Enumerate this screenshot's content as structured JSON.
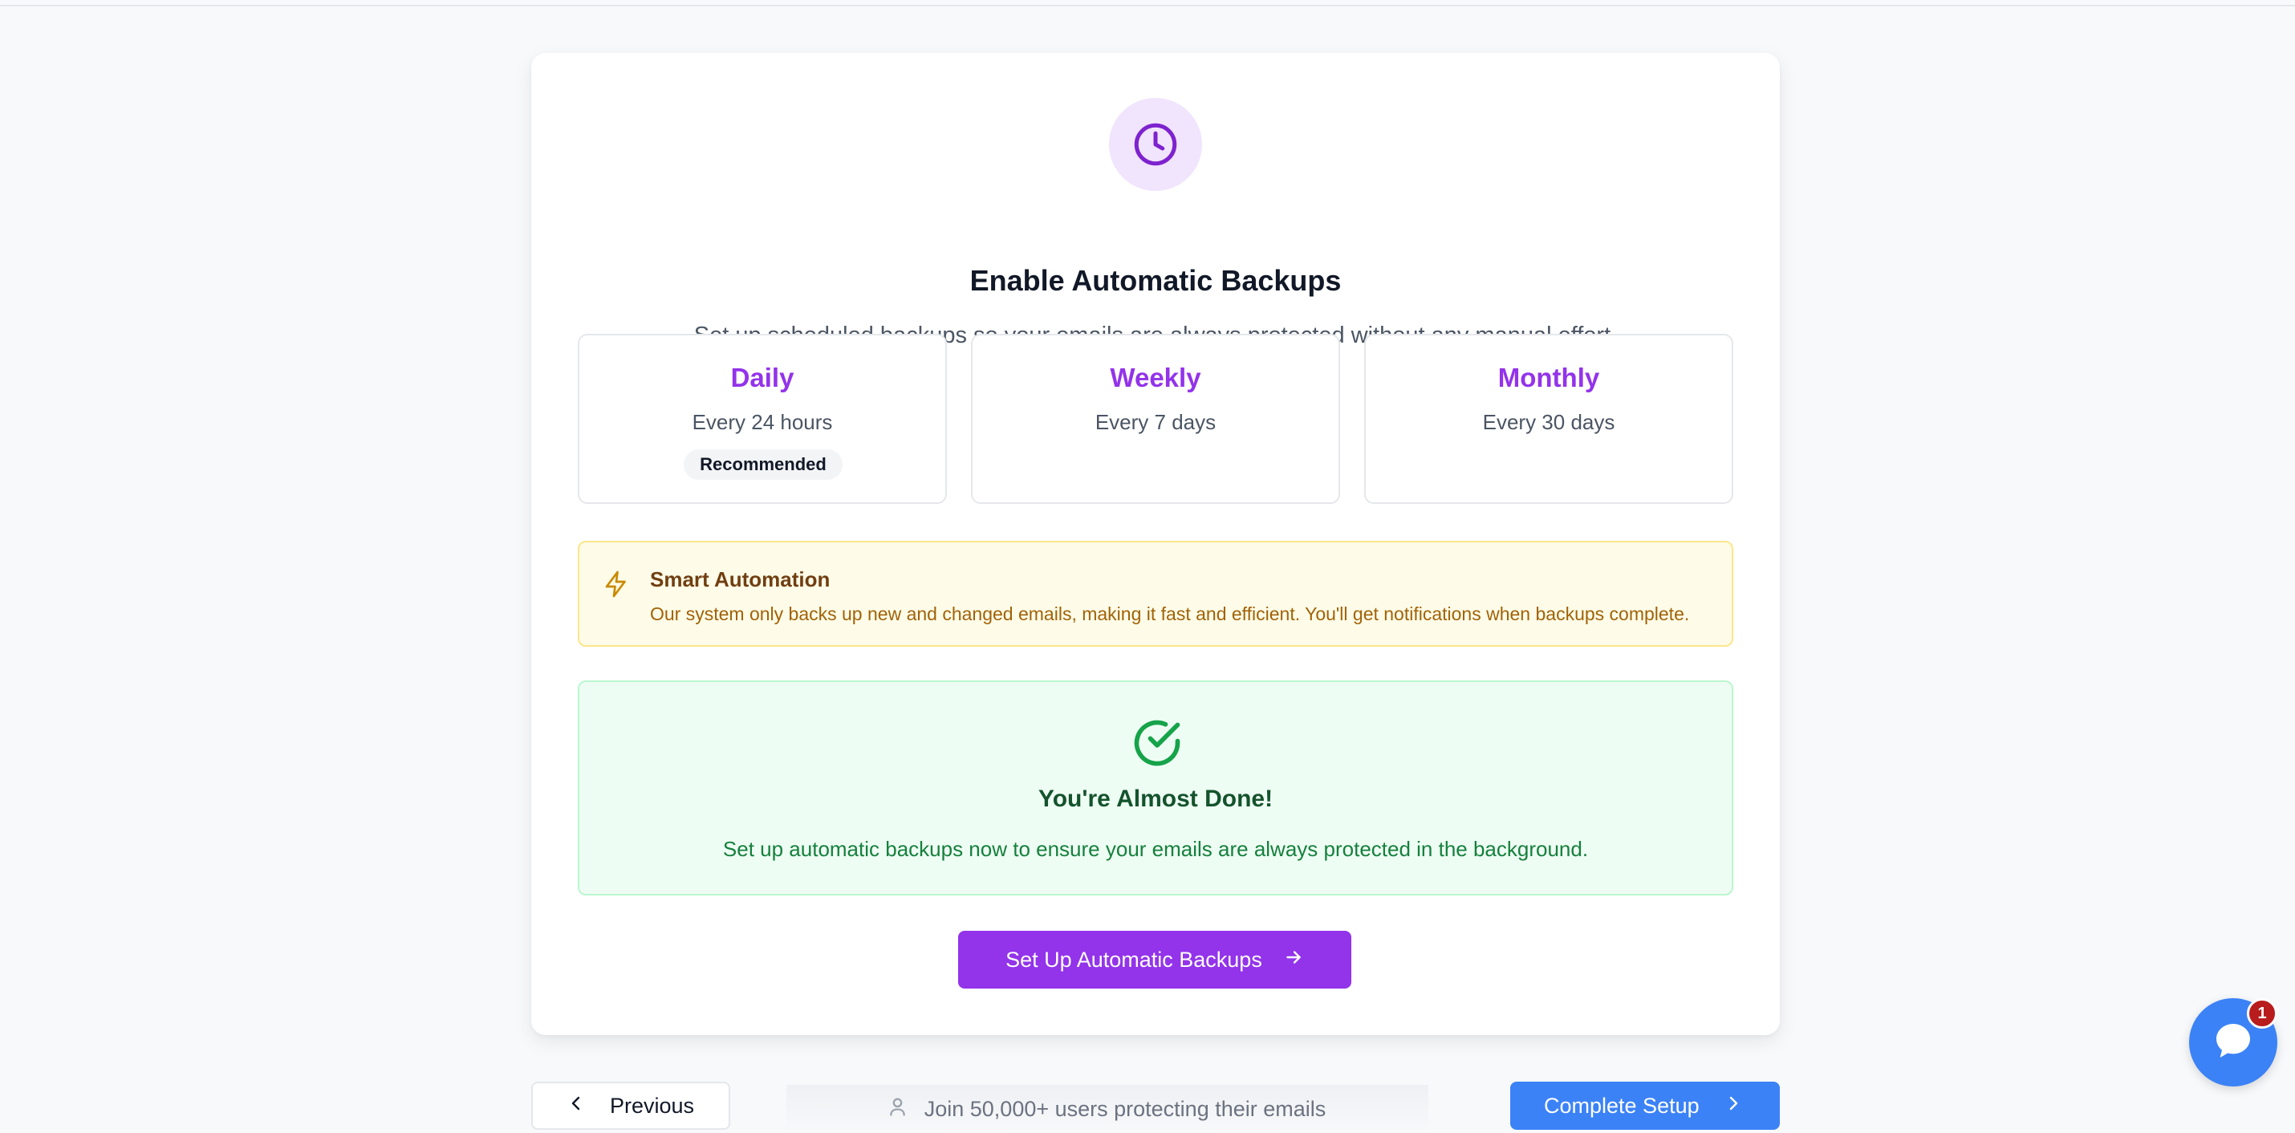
{
  "header": {
    "title": "Enable Automatic Backups",
    "subtitle": "Set up scheduled backups so your emails are always protected without any manual effort."
  },
  "frequencies": [
    {
      "name": "Daily",
      "desc": "Every 24 hours",
      "badge": "Recommended"
    },
    {
      "name": "Weekly",
      "desc": "Every 7 days"
    },
    {
      "name": "Monthly",
      "desc": "Every 30 days"
    }
  ],
  "tip": {
    "title": "Smart Automation",
    "text": "Our system only backs up new and changed emails, making it fast and efficient. You'll get notifications when backups complete."
  },
  "done": {
    "title": "You're Almost Done!",
    "text": "Set up automatic backups now to ensure your emails are always protected in the background."
  },
  "cta": {
    "label": "Set Up Automatic Backups"
  },
  "footer": {
    "previous": "Previous",
    "social_proof": "Join 50,000+ users protecting their emails",
    "next": "Complete Setup"
  },
  "chat": {
    "unread": "1"
  },
  "colors": {
    "accent": "#9333ea",
    "tip_bg": "#fefce8",
    "success_bg": "#eefdf3",
    "next_button": "#3b82f6",
    "chat_badge": "#b91c1c"
  },
  "icons": {
    "hero": "clock-icon",
    "tip": "lightning-icon",
    "done": "check-circle-icon",
    "cta": "arrow-right-icon",
    "previous": "chevron-left-icon",
    "users": "users-icon",
    "next": "chevron-right-icon",
    "chat": "chat-bubble-icon"
  }
}
